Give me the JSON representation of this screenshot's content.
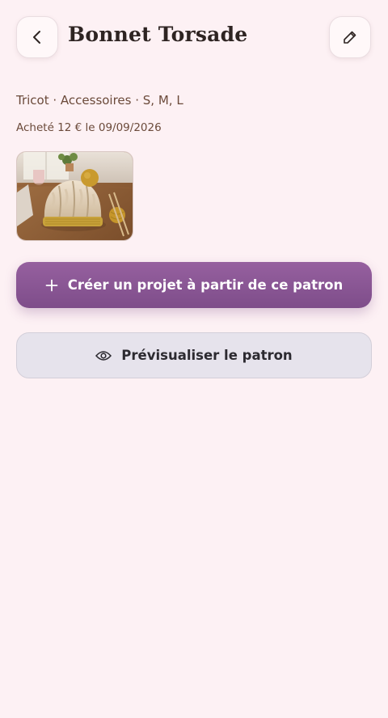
{
  "header": {
    "title": "Bonnet Torsade",
    "back_icon": "chevron-left-icon",
    "edit_icon": "pencil-icon"
  },
  "details": {
    "category_line": "Tricot · Accessoires · S, M, L",
    "purchase_line": "Acheté 12 € le 09/09/2026"
  },
  "image": {
    "subject": "cable-knit beanie with pompom and yarn ball"
  },
  "actions": {
    "create_project_label": "Créer un projet à partir de ce patron",
    "create_project_icon": "plus-icon",
    "preview_label": "Prévisualiser le patron",
    "preview_icon": "eye-icon"
  },
  "colors": {
    "background": "#fdf1f4",
    "primary": "#87538f",
    "secondary": "#e6e3ec",
    "text_brown": "#6b4a3a"
  }
}
